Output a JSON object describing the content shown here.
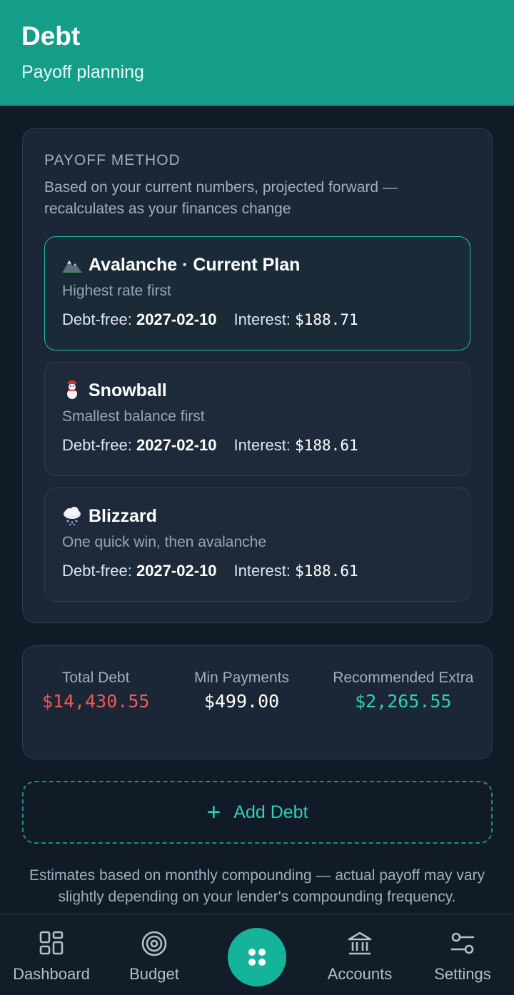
{
  "header": {
    "title": "Debt",
    "subtitle": "Payoff planning"
  },
  "payoff": {
    "section_title": "PAYOFF METHOD",
    "description": "Based on your current numbers, projected forward — recalculates as your finances change",
    "methods": [
      {
        "name": "Avalanche · Current Plan",
        "desc": "Highest rate first",
        "debt_free_label": "Debt-free:",
        "debt_free": "2027-02-10",
        "interest_label": "Interest:",
        "interest": "$188.71",
        "icon": "mountain-icon",
        "active": true
      },
      {
        "name": "Snowball",
        "desc": "Smallest balance first",
        "debt_free_label": "Debt-free:",
        "debt_free": "2027-02-10",
        "interest_label": "Interest:",
        "interest": "$188.61",
        "icon": "snowman-icon",
        "active": false
      },
      {
        "name": "Blizzard",
        "desc": "One quick win, then avalanche",
        "debt_free_label": "Debt-free:",
        "debt_free": "2027-02-10",
        "interest_label": "Interest:",
        "interest": "$188.61",
        "icon": "snow-cloud-icon",
        "active": false
      }
    ]
  },
  "summary": {
    "total_debt_label": "Total Debt",
    "total_debt": "$14,430.55",
    "min_payments_label": "Min Payments",
    "min_payments": "$499.00",
    "recommended_label": "Recommended Extra",
    "recommended": "$2,265.55"
  },
  "add_debt": {
    "plus": "+",
    "label": "Add Debt"
  },
  "footnote": "Estimates based on monthly compounding — actual payoff may vary slightly depending on your lender's compounding frequency.",
  "nav": {
    "items": [
      {
        "label": "Dashboard",
        "icon": "dashboard-icon"
      },
      {
        "label": "Budget",
        "icon": "target-icon"
      },
      {
        "label": "",
        "icon": "apps-icon"
      },
      {
        "label": "Accounts",
        "icon": "bank-icon"
      },
      {
        "label": "Settings",
        "icon": "sliders-icon"
      }
    ]
  },
  "colors": {
    "header": "#149e8a",
    "accent": "#2fd2b6",
    "negative": "#ef5a57",
    "background": "#111a27"
  }
}
